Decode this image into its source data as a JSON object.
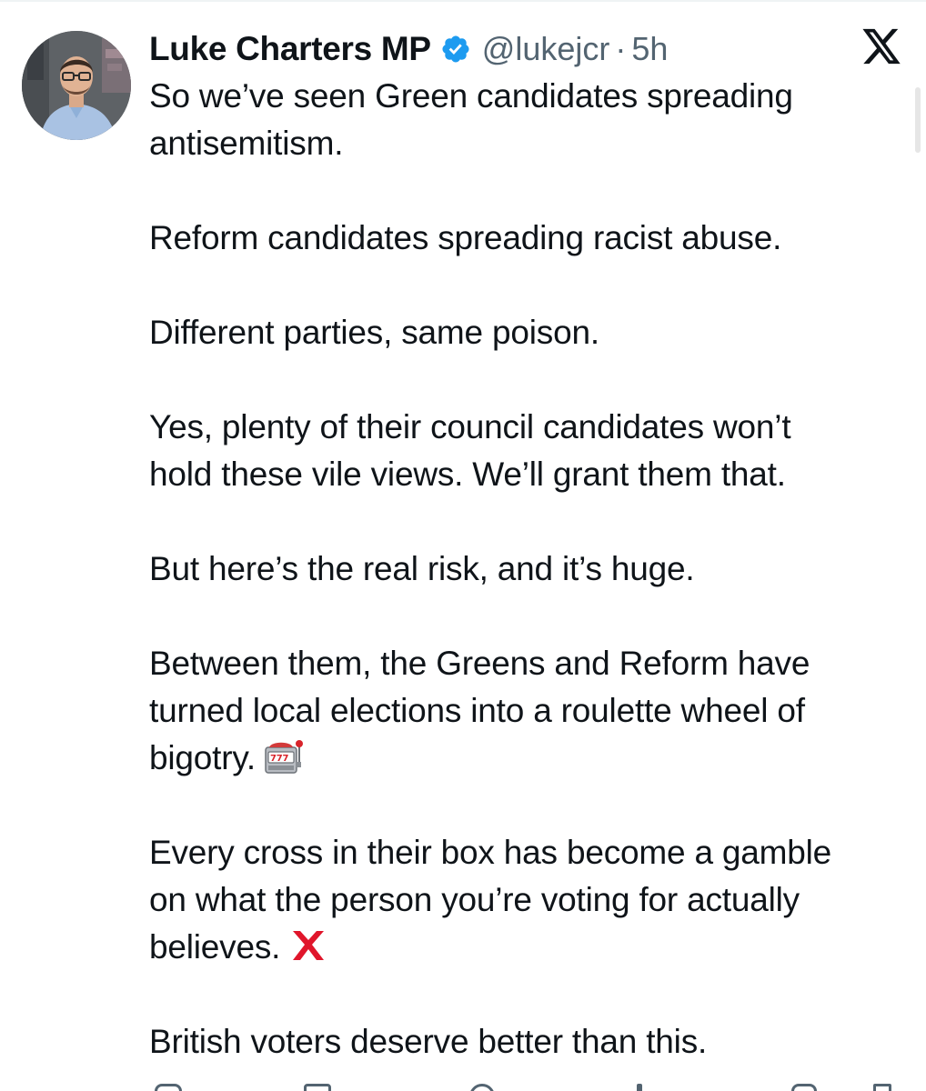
{
  "tweet": {
    "author": {
      "display_name": "Luke Charters MP",
      "handle": "@lukejcr",
      "separator": "·",
      "time": "5h",
      "verified": true,
      "verified_color": "#1d9bf0"
    },
    "platform_icon": "x-logo-icon",
    "paragraphs": [
      {
        "text": "So we’ve seen Green candidates spreading\nantisemitism."
      },
      {
        "text": "Reform candidates spreading racist abuse."
      },
      {
        "text": "Different parties, same poison."
      },
      {
        "text": "Yes, plenty of their council candidates won’t\nhold these vile views. We’ll grant them that."
      },
      {
        "text": "But here’s the real risk, and it’s huge."
      },
      {
        "text": "Between them, the Greens and Reform have\nturned local elections into a roulette wheel of\nbigotry.",
        "emoji": "slot-machine-icon"
      },
      {
        "text": "Every cross in their box has become a gamble\non what the person you’re voting for actually\nbelieves.",
        "emoji": "cross-mark-icon"
      },
      {
        "text": "British voters deserve better than this."
      }
    ]
  },
  "colors": {
    "text": "#0f1419",
    "secondary": "#536471",
    "accent": "#1d9bf0",
    "cross_red": "#e0162b"
  }
}
